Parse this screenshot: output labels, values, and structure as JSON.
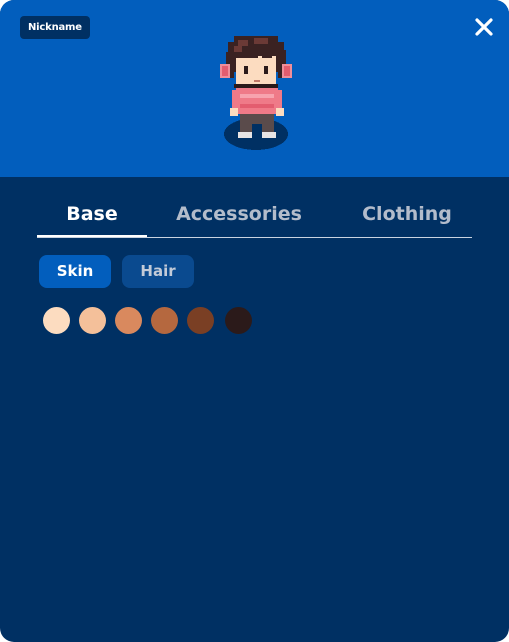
{
  "header": {
    "nickname_badge": "Nickname",
    "close_icon": "close-icon",
    "avatar": "pixel-character"
  },
  "tabs": [
    {
      "label": "Base",
      "active": true
    },
    {
      "label": "Accessories",
      "active": false
    },
    {
      "label": "Clothing",
      "active": false
    }
  ],
  "subtabs": [
    {
      "label": "Skin",
      "active": true
    },
    {
      "label": "Hair",
      "active": false
    }
  ],
  "skin_swatches": [
    "#fcdcc0",
    "#f4c09a",
    "#d9895e",
    "#b5683f",
    "#7a3f24",
    "#2b1a1a"
  ],
  "colors": {
    "header_bg": "#025ebd",
    "panel_bg": "#003063",
    "accent": "#025ebd"
  }
}
